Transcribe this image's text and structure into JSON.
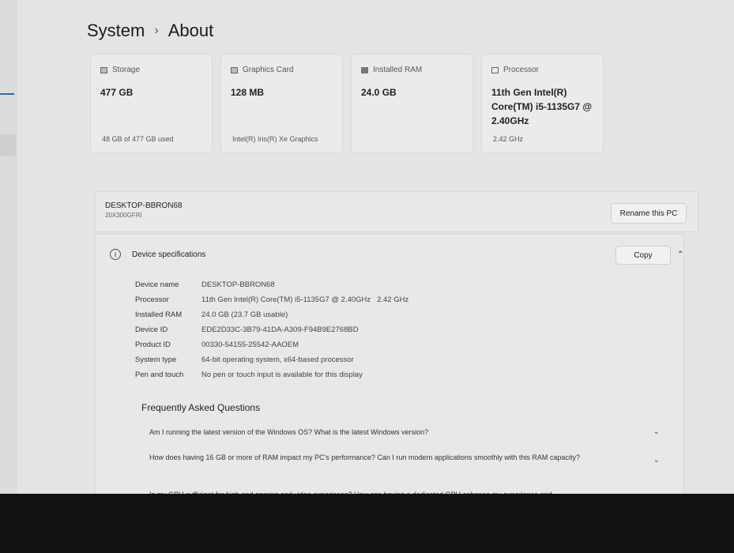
{
  "breadcrumb": {
    "parent": "System",
    "current": "About"
  },
  "cards": [
    {
      "label": "Storage",
      "value": "477 GB",
      "sub": "48 GB of 477 GB used",
      "icon": "storage-icon"
    },
    {
      "label": "Graphics Card",
      "value": "128 MB",
      "sub": "Intel(R) Iris(R) Xe Graphics",
      "icon": "graphics-card-icon"
    },
    {
      "label": "Installed RAM",
      "value": "24.0 GB",
      "sub": "",
      "icon": "ram-icon"
    },
    {
      "label": "Processor",
      "value": "11th Gen Intel(R) Core(TM) i5-1135G7 @ 2.40GHz",
      "sub": "2.42 GHz",
      "icon": "processor-icon"
    }
  ],
  "pc": {
    "name": "DESKTOP-BBRON68",
    "model": "20X300GFRI",
    "rename_label": "Rename this PC"
  },
  "specs": {
    "title": "Device specifications",
    "copy_label": "Copy",
    "rows": [
      {
        "k": "Device name",
        "v": "DESKTOP-BBRON68"
      },
      {
        "k": "Processor",
        "v": "11th Gen Intel(R) Core(TM) i5-1135G7 @ 2.40GHz   2.42 GHz"
      },
      {
        "k": "Installed RAM",
        "v": "24.0 GB (23.7 GB usable)"
      },
      {
        "k": "Device ID",
        "v": "EDE2D33C-3B79-41DA-A309-F94B9E2768BD"
      },
      {
        "k": "Product ID",
        "v": "00330-54155-25542-AAOEM"
      },
      {
        "k": "System type",
        "v": "64-bit operating system, x64-based processor"
      },
      {
        "k": "Pen and touch",
        "v": "No pen or touch input is available for this display"
      }
    ]
  },
  "faq": {
    "title": "Frequently Asked Questions",
    "items": [
      "Am I running the latest version of the Windows OS? What is the latest Windows version?",
      "How does having 16 GB or more of RAM impact my PC's performance? Can I run modern applications smoothly with this RAM capacity?",
      "Is my GPU sufficient for high end gaming and video experience? How can having a dedicated GPU enhance my experience and"
    ]
  }
}
